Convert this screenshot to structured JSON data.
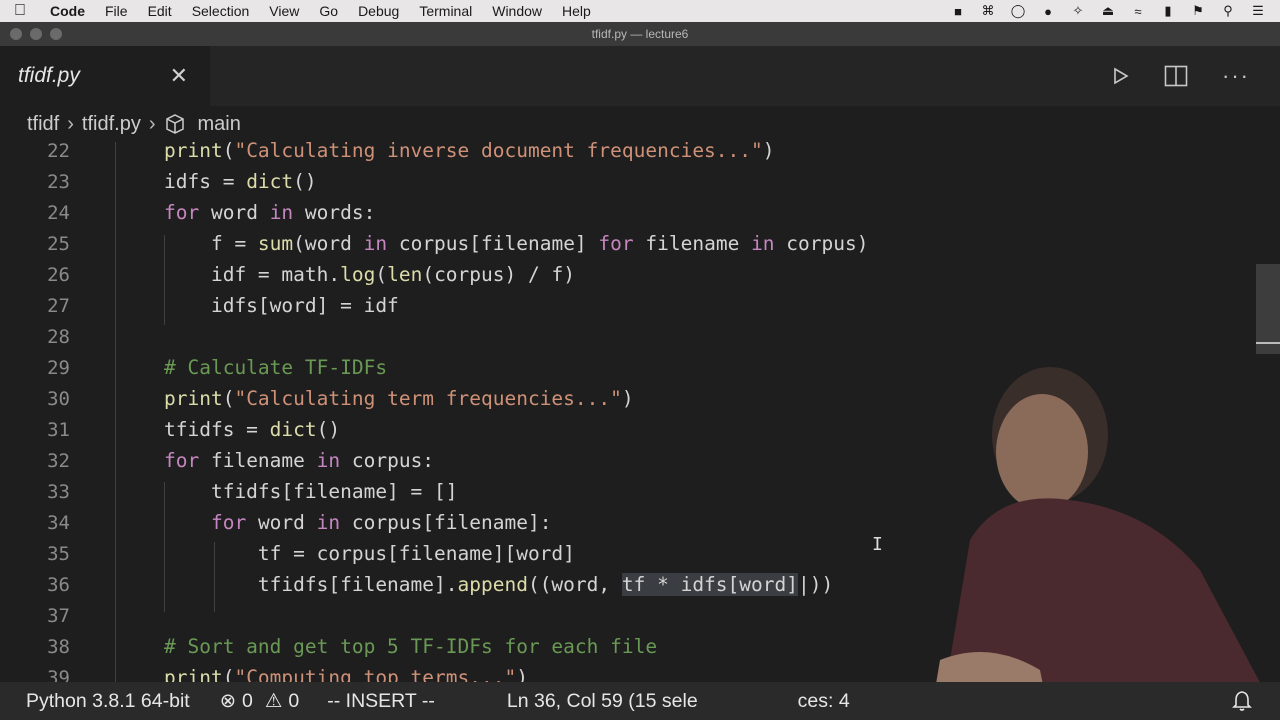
{
  "menubar": {
    "app": "Code",
    "items": [
      "File",
      "Edit",
      "Selection",
      "View",
      "Go",
      "Debug",
      "Terminal",
      "Window",
      "Help"
    ]
  },
  "window": {
    "title": "tfidf.py — lecture6"
  },
  "tab": {
    "label": "tfidf.py"
  },
  "breadcrumb": {
    "folder": "tfidf",
    "file": "tfidf.py",
    "symbol": "main"
  },
  "editor": {
    "lines": [
      {
        "n": "22",
        "code": "print(\"Calculating inverse document frequencies...\")"
      },
      {
        "n": "23",
        "code": "idfs = dict()"
      },
      {
        "n": "24",
        "code": "for word in words:"
      },
      {
        "n": "25",
        "code": "    f = sum(word in corpus[filename] for filename in corpus)"
      },
      {
        "n": "26",
        "code": "    idf = math.log(len(corpus) / f)"
      },
      {
        "n": "27",
        "code": "    idfs[word] = idf"
      },
      {
        "n": "28",
        "code": ""
      },
      {
        "n": "29",
        "code": "# Calculate TF-IDFs"
      },
      {
        "n": "30",
        "code": "print(\"Calculating term frequencies...\")"
      },
      {
        "n": "31",
        "code": "tfidfs = dict()"
      },
      {
        "n": "32",
        "code": "for filename in corpus:"
      },
      {
        "n": "33",
        "code": "    tfidfs[filename] = []"
      },
      {
        "n": "34",
        "code": "    for word in corpus[filename]:"
      },
      {
        "n": "35",
        "code": "        tf = corpus[filename][word]"
      },
      {
        "n": "36",
        "code": "        tfidfs[filename].append((word, tf * idfs[word]))"
      },
      {
        "n": "37",
        "code": ""
      },
      {
        "n": "38",
        "code": "# Sort and get top 5 TF-IDFs for each file"
      },
      {
        "n": "39",
        "code": "print(\"Computing top terms...\")"
      }
    ]
  },
  "statusbar": {
    "python": "Python 3.8.1 64-bit",
    "errors": "0",
    "warnings": "0",
    "mode": "-- INSERT --",
    "position": "Ln 36, Col 59 (15 sele",
    "spaces": "ces: 4"
  },
  "colors": {
    "editor_bg": "#1e1e1e",
    "keyword": "#c586c0",
    "function": "#dcdcaa",
    "string": "#ce9178",
    "comment": "#6a9955"
  }
}
